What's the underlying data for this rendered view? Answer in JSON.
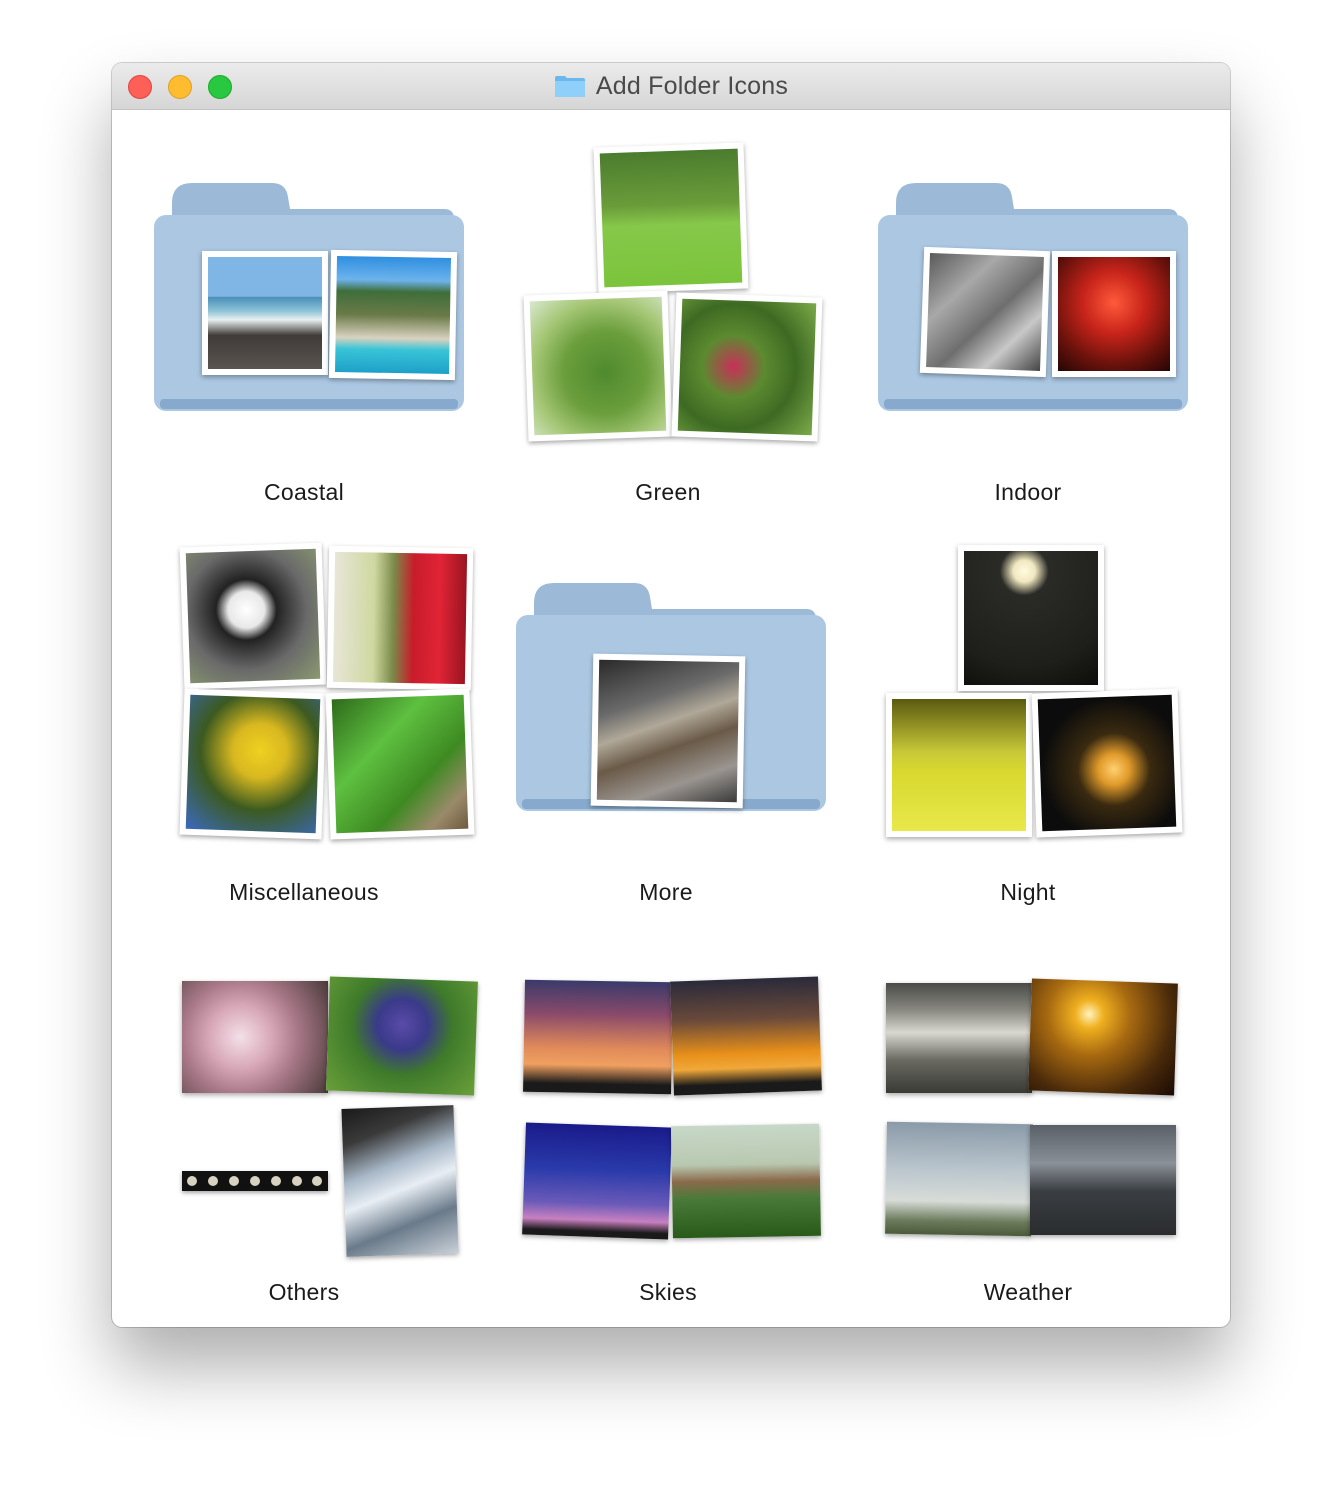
{
  "window": {
    "title": "Add Folder Icons"
  },
  "folders": [
    {
      "label": "Coastal"
    },
    {
      "label": "Green"
    },
    {
      "label": "Indoor"
    },
    {
      "label": "Miscellaneous"
    },
    {
      "label": "More"
    },
    {
      "label": "Night"
    },
    {
      "label": "Others"
    },
    {
      "label": "Skies"
    },
    {
      "label": "Weather"
    }
  ],
  "colors": {
    "folder_blue": "#a8c4e0",
    "folder_blue_dark": "#86a9cd"
  }
}
